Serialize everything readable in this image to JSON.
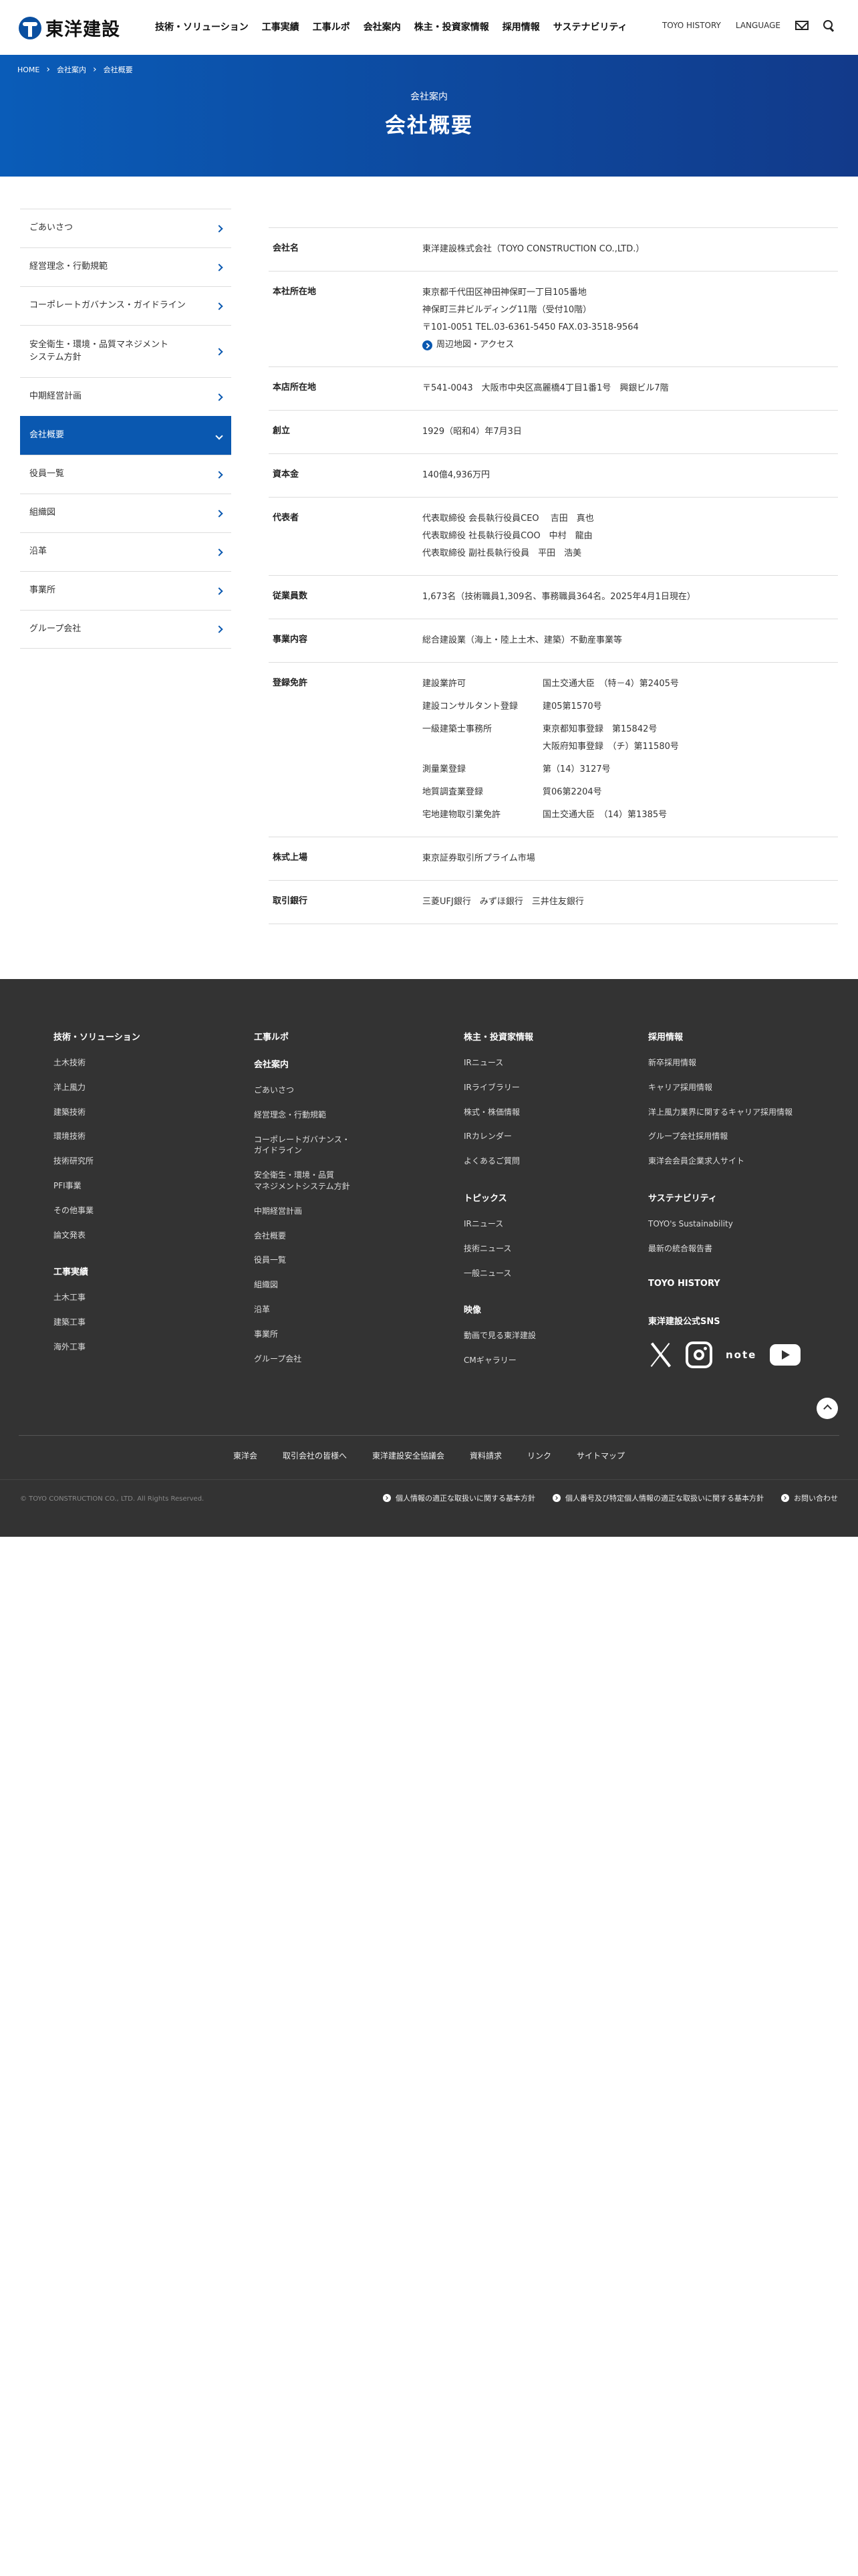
{
  "header": {
    "logo_text": "東洋建設",
    "nav": [
      "技術・ソリューション",
      "工事実績",
      "工事ルポ",
      "会社案内",
      "株主・投資家情報",
      "採用情報",
      "サステナビリティ"
    ],
    "history": "TOYO HISTORY",
    "language": "LANGUAGE"
  },
  "breadcrumb": [
    "HOME",
    "会社案内",
    "会社概要"
  ],
  "hero": {
    "subtitle": "会社案内",
    "title": "会社概要"
  },
  "sidebar": [
    {
      "label": "ごあいさつ"
    },
    {
      "label": "経営理念・行動規範"
    },
    {
      "label": "コーポレートガバナンス・ガイドライン"
    },
    {
      "label": "安全衛生・環境・品質マネジメント\nシステム方針"
    },
    {
      "label": "中期経営計画"
    },
    {
      "label": "会社概要"
    },
    {
      "label": "役員一覧"
    },
    {
      "label": "組織図"
    },
    {
      "label": "沿革"
    },
    {
      "label": "事業所"
    },
    {
      "label": "グループ会社"
    }
  ],
  "profile": {
    "name_label": "会社名",
    "name": "東洋建設株式会社（TOYO CONSTRUCTION CO.,LTD.）",
    "hq_label": "本社所在地",
    "hq1": "東京都千代田区神田神保町一丁目105番地",
    "hq2": "神保町三井ビルディング11階（受付10階）",
    "hq3": "〒101-0051 TEL.03-6361-5450 FAX.03-3518-9564",
    "hq_link": "周辺地図・アクセス",
    "head_label": "本店所在地",
    "head": "〒541-0043　大阪市中央区高麗橋4丁目1番1号　興銀ビル7階",
    "founded_label": "創立",
    "founded": "1929（昭和4）年7月3日",
    "capital_label": "資本金",
    "capital": "140億4,936万円",
    "rep_label": "代表者",
    "rep1": "代表取締役 会長執行役員CEO　 吉田　真也",
    "rep2": "代表取締役 社長執行役員COO　中村　龍由",
    "rep3": "代表取締役 副社長執行役員　平田　浩美",
    "emp_label": "従業員数",
    "emp": "1,673名（技術職員1,309名、事務職員364名。2025年4月1日現在）",
    "biz_label": "事業内容",
    "biz": "総合建設業（海上・陸上土木、建築）不動産事業等",
    "reg_label": "登録免許",
    "reg": [
      {
        "name": "建設業許可",
        "values": [
          "国土交通大臣　（特－4）第2405号"
        ]
      },
      {
        "name": "建設コンサルタント登録",
        "values": [
          "建05第1570号"
        ]
      },
      {
        "name": "一級建築士事務所",
        "values": [
          "東京都知事登録　第15842号",
          "大阪府知事登録　（チ）第11580号"
        ]
      },
      {
        "name": "測量業登録",
        "values": [
          "第（14）3127号"
        ]
      },
      {
        "name": "地質調査業登録",
        "values": [
          "質06第2204号"
        ]
      },
      {
        "name": "宅地建物取引業免許",
        "values": [
          "国土交通大臣　（14）第1385号"
        ]
      }
    ],
    "listing_label": "株式上場",
    "listing": "東京証券取引所プライム市場",
    "bank_label": "取引銀行",
    "bank": "三菱UFJ銀行　みずほ銀行　三井住友銀行"
  },
  "footer": {
    "col1_h1": "技術・ソリューション",
    "col1_links": [
      "土木技術",
      "洋上風力",
      "建築技術",
      "環境技術",
      "技術研究所",
      "PFI事業",
      "その他事業",
      "論文発表"
    ],
    "col1_h2": "工事実績",
    "col1_links2": [
      "土木工事",
      "建築工事",
      "海外工事"
    ],
    "col2_h1": "工事ルポ",
    "col2_h2": "会社案内",
    "col2_links": [
      "ごあいさつ",
      "経営理念・行動規範",
      "コーポレートガバナンス・\nガイドライン",
      "安全衛生・環境・品質\nマネジメントシステム方針",
      "中期経営計画",
      "会社概要",
      "役員一覧",
      "組織図",
      "沿革",
      "事業所",
      "グループ会社"
    ],
    "col3_h1": "株主・投資家情報",
    "col3_links": [
      "IRニュース",
      "IRライブラリー",
      "株式・株価情報",
      "IRカレンダー",
      "よくあるご質問"
    ],
    "col3_h2": "トピックス",
    "col3_links2": [
      "IRニュース",
      "技術ニュース",
      "一般ニュース"
    ],
    "col3_h3": "映像",
    "col3_links3": [
      "動画で見る東洋建設",
      "CMギャラリー"
    ],
    "col4_h1": "採用情報",
    "col4_links": [
      "新卒採用情報",
      "キャリア採用情報",
      "洋上風力業界に関するキャリア採用情報",
      "グループ会社採用情報",
      "東洋会会員企業求人サイト"
    ],
    "col4_h2": "サステナビリティ",
    "col4_links2": [
      "TOYO's Sustainability",
      "最新の統合報告書"
    ],
    "col4_h3": "TOYO HISTORY",
    "col4_h4": "東洋建設公式SNS",
    "note_text": "note",
    "bar": [
      "東洋会",
      "取引会社の皆様へ",
      "東洋建設安全協議会",
      "資料請求",
      "リンク",
      "サイトマップ"
    ],
    "copyright": "© TOYO CONSTRUCTION CO., LTD. All Rights Reserved.",
    "policies": [
      "個人情報の適正な取扱いに関する基本方針",
      "個人番号及び特定個人情報の適正な取扱いに関する基本方針",
      "お問い合わせ"
    ]
  }
}
